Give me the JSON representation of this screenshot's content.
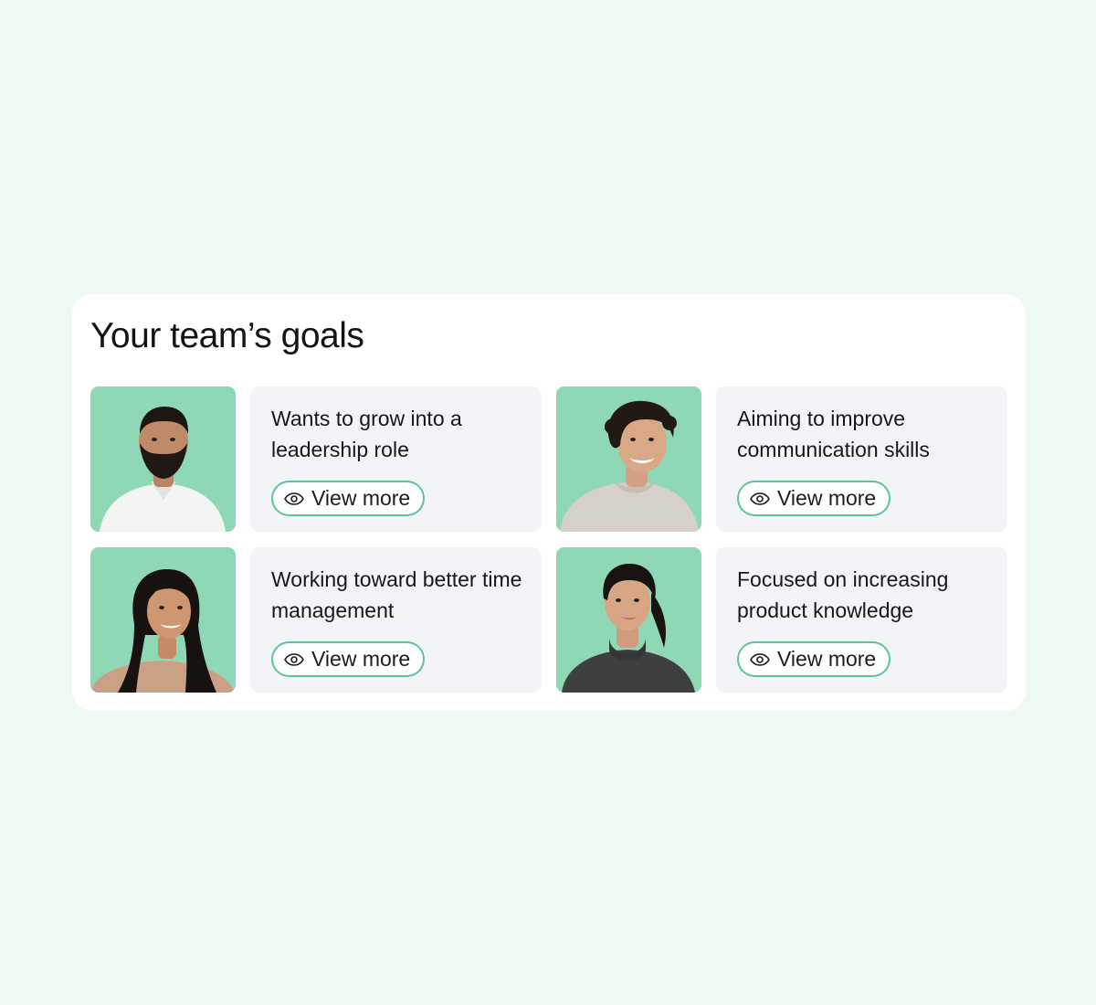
{
  "card": {
    "title": "Your team’s goals"
  },
  "goals": [
    {
      "text": "Wants to grow into a leadership role",
      "button_label": "View more",
      "button_icon": "eye-icon"
    },
    {
      "text": "Aiming to improve communication skills",
      "button_label": "View more",
      "button_icon": "eye-icon"
    },
    {
      "text": "Working toward better time management",
      "button_label": "View more",
      "button_icon": "eye-icon"
    },
    {
      "text": "Focused on increasing product knowledge",
      "button_label": "View more",
      "button_icon": "eye-icon"
    }
  ],
  "colors": {
    "page_background": "#eef9f2",
    "avatar_background": "#8fd8b6",
    "button_border": "#5cc497",
    "panel_background": "#f3f4f8"
  }
}
